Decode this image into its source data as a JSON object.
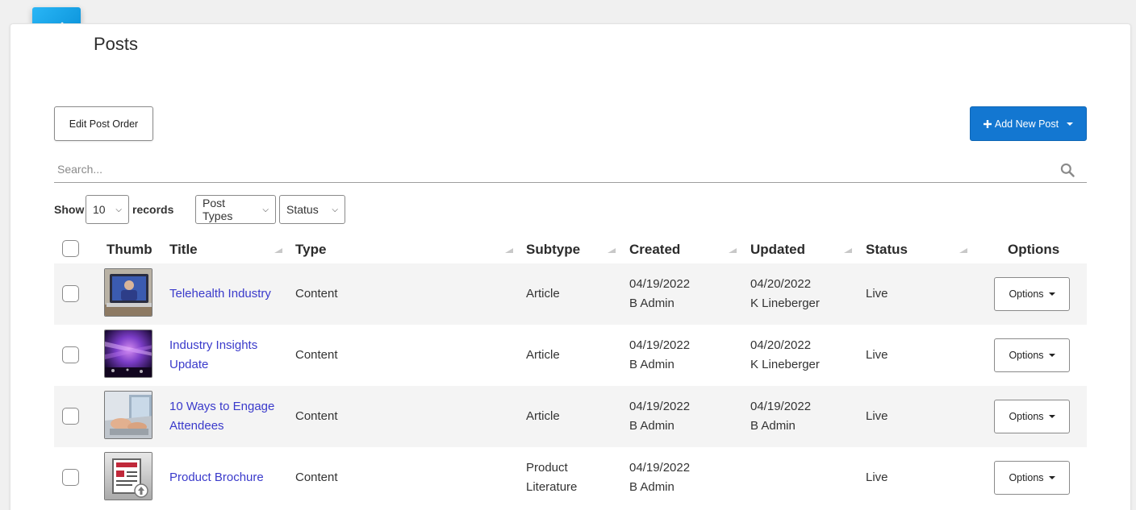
{
  "page": {
    "title": "Posts",
    "header_icon": "pencil-icon"
  },
  "toolbar": {
    "edit_order_label": "Edit Post Order",
    "add_new_label": "Add New Post",
    "add_new_icon": "plus-icon",
    "accent_color": "#1377d1"
  },
  "search": {
    "placeholder": "Search...",
    "value": ""
  },
  "filters": {
    "show_label": "Show",
    "records_value": "10",
    "records_label": "records",
    "post_types": "Post Types",
    "status": "Status"
  },
  "table": {
    "headers": {
      "thumb": "Thumb",
      "title": "Title",
      "type": "Type",
      "subtype": "Subtype",
      "created": "Created",
      "updated": "Updated",
      "status": "Status",
      "options": "Options"
    },
    "rows": [
      {
        "thumb": "laptop-video-call-image",
        "title_line1": "Telehealth Industry",
        "title_line2": "",
        "type": "Content",
        "subtype_line1": "Article",
        "subtype_line2": "",
        "created_date": "04/19/2022",
        "created_by": "B Admin",
        "updated_date": "04/20/2022",
        "updated_by": "K Lineberger",
        "status": "Live",
        "options_label": "Options"
      },
      {
        "thumb": "purple-concert-lights-image",
        "title_line1": "Industry Insights",
        "title_line2": "Update",
        "type": "Content",
        "subtype_line1": "Article",
        "subtype_line2": "",
        "created_date": "04/19/2022",
        "created_by": "B Admin",
        "updated_date": "04/20/2022",
        "updated_by": "K Lineberger",
        "status": "Live",
        "options_label": "Options"
      },
      {
        "thumb": "hands-typing-laptop-image",
        "title_line1": "10 Ways to Engage",
        "title_line2": "Attendees",
        "type": "Content",
        "subtype_line1": "Article",
        "subtype_line2": "",
        "created_date": "04/19/2022",
        "created_by": "B Admin",
        "updated_date": "04/19/2022",
        "updated_by": "B Admin",
        "status": "Live",
        "options_label": "Options"
      },
      {
        "thumb": "document-upload-icon",
        "title_line1": "Product Brochure",
        "title_line2": "",
        "type": "Content",
        "subtype_line1": "Product",
        "subtype_line2": "Literature",
        "created_date": "04/19/2022",
        "created_by": "B Admin",
        "updated_date": "",
        "updated_by": "",
        "status": "Live",
        "options_label": "Options"
      }
    ]
  }
}
